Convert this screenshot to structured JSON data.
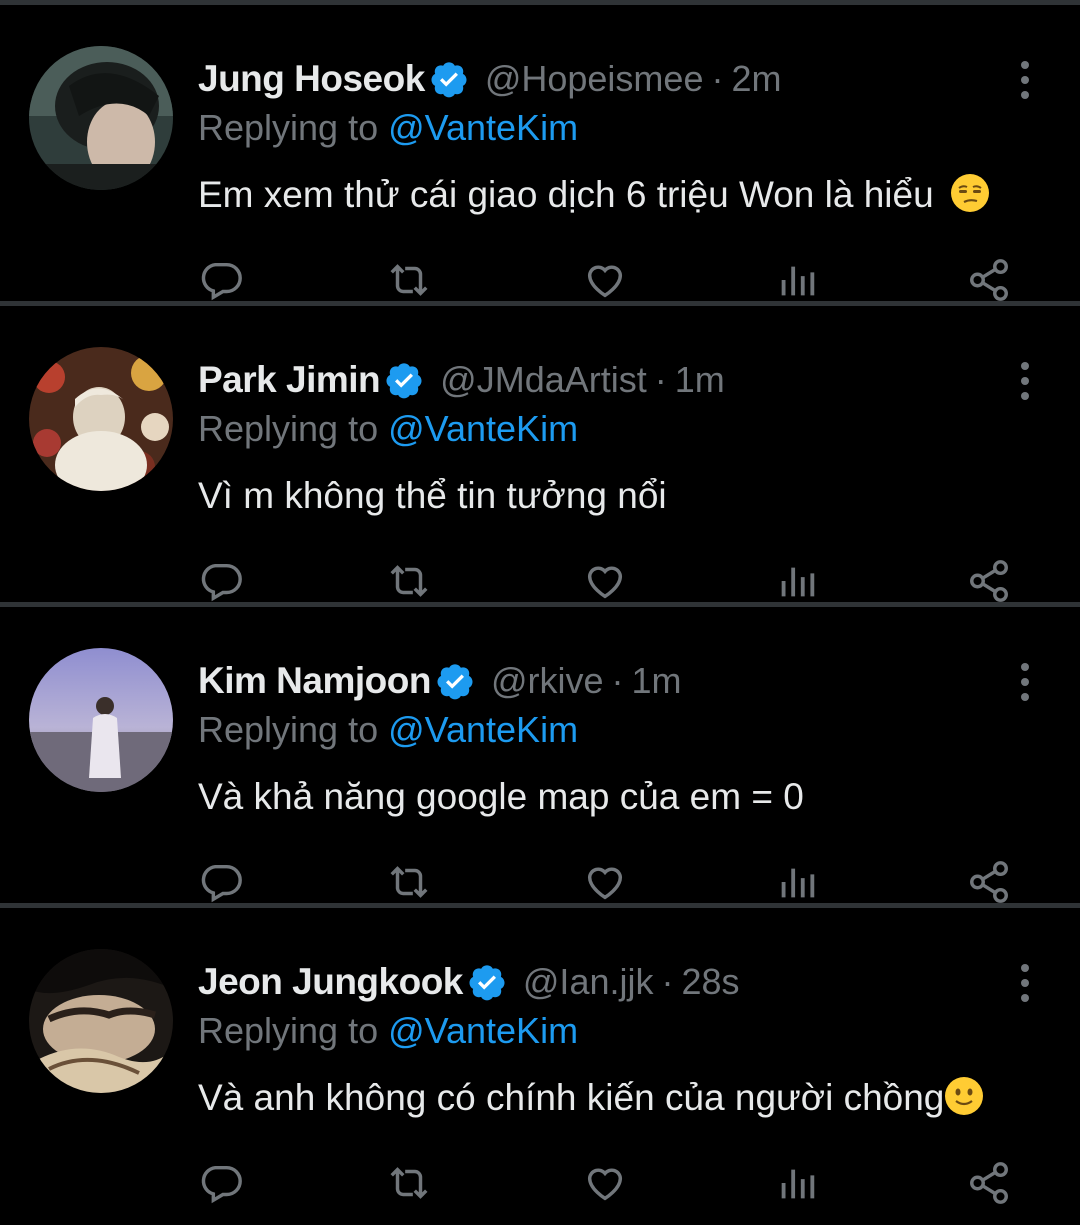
{
  "tweets": [
    {
      "name": "Jung Hoseok",
      "handle": "@Hopeismee",
      "time": "2m",
      "replying_prefix": "Replying to ",
      "replying_to": "@VanteKim",
      "text": "Em xem thử cái giao dịch 6 triệu Won là hiểu",
      "emoji": "unamused-face",
      "avatar_colors": [
        "#3a4a48",
        "#1f2524",
        "#c9b7a8"
      ]
    },
    {
      "name": "Park Jimin",
      "handle": "@JMdaArtist",
      "time": "1m",
      "replying_prefix": "Replying to ",
      "replying_to": "@VanteKim",
      "text": "Vì m không thể tin tưởng nổi",
      "emoji": "",
      "avatar_colors": [
        "#6b3a2a",
        "#d8d2c2",
        "#a23a2c"
      ]
    },
    {
      "name": "Kim Namjoon",
      "handle": "@rkive",
      "time": "1m",
      "replying_prefix": "Replying to ",
      "replying_to": "@VanteKim",
      "text": "Và khả năng google map của em = 0",
      "emoji": "",
      "avatar_colors": [
        "#8e8cc8",
        "#6a6a8a",
        "#e8e4ee"
      ]
    },
    {
      "name": "Jeon Jungkook",
      "handle": "@Ian.jjk",
      "time": "28s",
      "replying_prefix": "Replying to ",
      "replying_to": "@VanteKim",
      "text": "Và anh không có chính kiến của người chồng",
      "emoji": "slightly-smiling-face",
      "avatar_colors": [
        "#2a2420",
        "#c9b49a",
        "#6a5040"
      ]
    }
  ],
  "actions": [
    "reply-icon",
    "retweet-icon",
    "like-icon",
    "analytics-icon",
    "share-icon"
  ],
  "colors": {
    "background": "#000000",
    "divider": "#2f3336",
    "text": "#e7e9ea",
    "muted": "#71767b",
    "accent": "#1d9bf0"
  }
}
